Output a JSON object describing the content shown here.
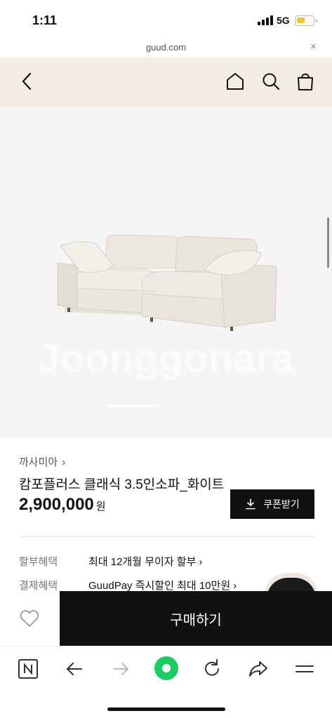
{
  "status_bar": {
    "time": "1:11",
    "network": "5G"
  },
  "browser": {
    "url": "guud.com",
    "close_label": "×"
  },
  "header": {
    "icons": [
      "back-arrow-icon",
      "home-icon",
      "search-icon",
      "shopping-bag-icon"
    ],
    "background": "#f3ece4"
  },
  "product": {
    "image_watermark": "Joonggonara",
    "brand": "까사미아",
    "brand_chevron": "›",
    "title": "캄포플러스 클래식 3.5인소파_화이트",
    "price": "2,900,000",
    "currency": "원",
    "coupon_button": "쿠폰받기",
    "benefits": [
      {
        "label": "할부혜택",
        "value": "최대 12개월 무이자 할부 ›"
      },
      {
        "label": "결제혜택",
        "value": "GuudPay 즉시할인 최대 10만원 ›"
      }
    ]
  },
  "bottom_bar": {
    "buy_button": "구매하기"
  },
  "toolbar": {
    "icons": [
      "naver-n-icon",
      "back-icon",
      "forward-icon",
      "green-dot-icon",
      "refresh-icon",
      "share-icon",
      "menu-icon"
    ]
  },
  "colors": {
    "accent_green": "#19ce60",
    "dark": "#111111"
  }
}
